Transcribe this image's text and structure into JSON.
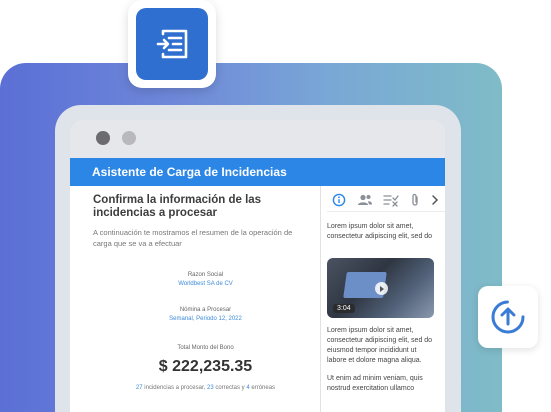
{
  "window": {
    "header_title": "Asistente de Carga de Incidencias"
  },
  "main": {
    "title": "Confirma la información de las incidencias a procesar",
    "description": "A continuación te mostramos el resumen de la operación de carga que se va a efectuar",
    "fields": [
      {
        "label": "Razon Social",
        "value": "Worldbest SA de CV"
      },
      {
        "label": "Nómina a Procesar",
        "value": "Semanal, Periodo 12, 2022"
      }
    ],
    "amount_label": "Total Monto del Bono",
    "amount_value": "$ 222,235.35",
    "summary": {
      "processed_count": "27",
      "processed_text": " incidencias a procesar, ",
      "correct_count": "23",
      "correct_text": " correctas y ",
      "error_count": "4",
      "error_text": " erróneas"
    }
  },
  "sidebar": {
    "tabs": [
      "info-icon",
      "users-icon",
      "checklist-icon",
      "attachment-icon",
      "chevron-right-icon"
    ],
    "paragraph1": "Lorem ipsum dolor sit amet, consectetur adipiscing elit, sed do",
    "video_duration": "3:04",
    "paragraph2": "Lorem ipsum dolor sit amet, consectetur adipiscing elit, sed do eiusmod tempor incididunt ut labore et dolore magna aliqua.",
    "paragraph3": "Ut enim ad minim veniam, quis nostrud exercitation ullamco"
  },
  "colors": {
    "accent": "#2b86e6",
    "link": "#3c8bd9",
    "badge": "#2f6fd0"
  }
}
